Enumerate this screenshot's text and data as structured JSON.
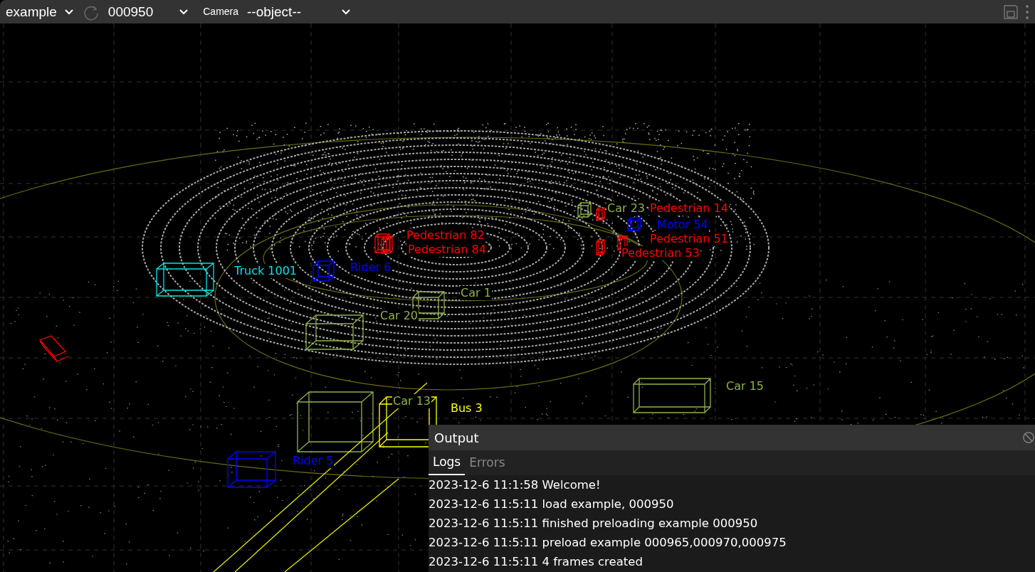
{
  "toolbar": {
    "scene": "example",
    "frame": "000950",
    "camera_label": "Camera",
    "camera_object": "--object--"
  },
  "objects": [
    {
      "label": "Car 23",
      "color": "#8fb24a"
    },
    {
      "label": "Pedestrian 14",
      "color": "#ff0000"
    },
    {
      "label": "Motor 54",
      "color": "#0000ff"
    },
    {
      "label": "Pedestrian 82",
      "color": "#ff0000"
    },
    {
      "label": "Pedestrian 84",
      "color": "#ff0000"
    },
    {
      "label": "Pedestrian 51",
      "color": "#ff0000"
    },
    {
      "label": "Pedestrian 53",
      "color": "#ff0000"
    },
    {
      "label": "Rider 6",
      "color": "#0000ff"
    },
    {
      "label": "Truck 1001",
      "color": "#00e5e5"
    },
    {
      "label": "Car 1",
      "color": "#8fb24a"
    },
    {
      "label": "Car 20",
      "color": "#8fb24a"
    },
    {
      "label": "Car 15",
      "color": "#8fb24a"
    },
    {
      "label": "Car 13",
      "color": "#8fb24a"
    },
    {
      "label": "Bus 3",
      "color": "#ffff00"
    },
    {
      "label": "Rider 5",
      "color": "#0000ff"
    }
  ],
  "output": {
    "title": "Output",
    "tabs": [
      {
        "label": "Logs",
        "selected": true
      },
      {
        "label": "Errors",
        "selected": false
      }
    ],
    "logs": [
      "2023-12-6 11:1:58 Welcome!",
      "2023-12-6 11:5:11 load example, 000950",
      "2023-12-6 11:5:11 finished preloading example 000950",
      "2023-12-6 11:5:11 preload example 000965,000970,000975",
      "2023-12-6 11:5:11 4 frames created"
    ]
  }
}
